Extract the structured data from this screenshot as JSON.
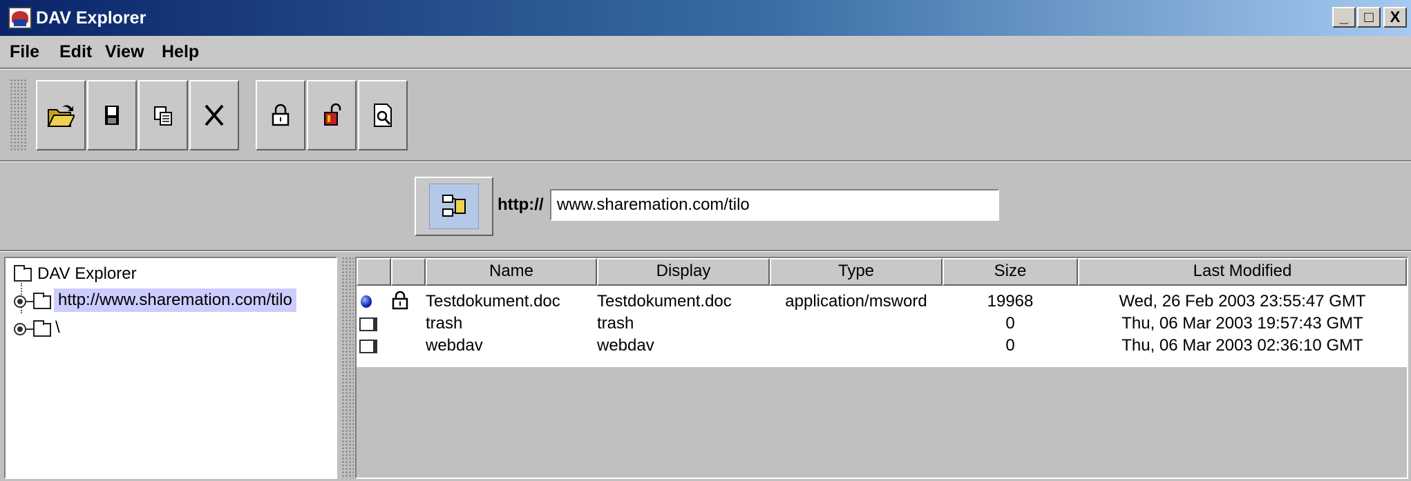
{
  "window": {
    "title": "DAV Explorer",
    "buttons": {
      "minimize": "_",
      "maximize": "□",
      "close": "X"
    }
  },
  "menu": [
    "File",
    "Edit",
    "View",
    "Help"
  ],
  "toolbar": {
    "buttons": [
      {
        "icon": "open-folder-icon"
      },
      {
        "icon": "save-icon"
      },
      {
        "icon": "copy-icon"
      },
      {
        "icon": "delete-icon"
      },
      {
        "icon": "lock-icon"
      },
      {
        "icon": "unlock-icon"
      },
      {
        "icon": "properties-icon"
      }
    ]
  },
  "address": {
    "prefix": "http://",
    "value": "www.sharemation.com/tilo",
    "connect_icon": "connect-server-icon"
  },
  "tree": {
    "root": "DAV Explorer",
    "nodes": [
      {
        "label": "http://www.sharemation.com/tilo",
        "selected": true
      },
      {
        "label": "\\",
        "selected": false
      }
    ]
  },
  "table": {
    "columns": [
      "",
      "",
      "Name",
      "Display",
      "Type",
      "Size",
      "Last Modified"
    ],
    "rows": [
      {
        "icon": "blue-dot-icon",
        "locked": true,
        "name": "Testdokument.doc",
        "display": "Testdokument.doc",
        "type": "application/msword",
        "size": "19968",
        "modified": "Wed, 26 Feb 2003 23:55:47 GMT"
      },
      {
        "icon": "collection-icon",
        "locked": false,
        "name": "trash",
        "display": "trash",
        "type": "",
        "size": "0",
        "modified": "Thu, 06 Mar 2003 19:57:43 GMT"
      },
      {
        "icon": "collection-icon",
        "locked": false,
        "name": "webdav",
        "display": "webdav",
        "type": "",
        "size": "0",
        "modified": "Thu, 06 Mar 2003 02:36:10 GMT"
      }
    ]
  },
  "colors": {
    "titlebar_start": "#0a246a",
    "titlebar_end": "#a6caf0",
    "selection": "#ccccff",
    "face": "#c0c0c0"
  }
}
